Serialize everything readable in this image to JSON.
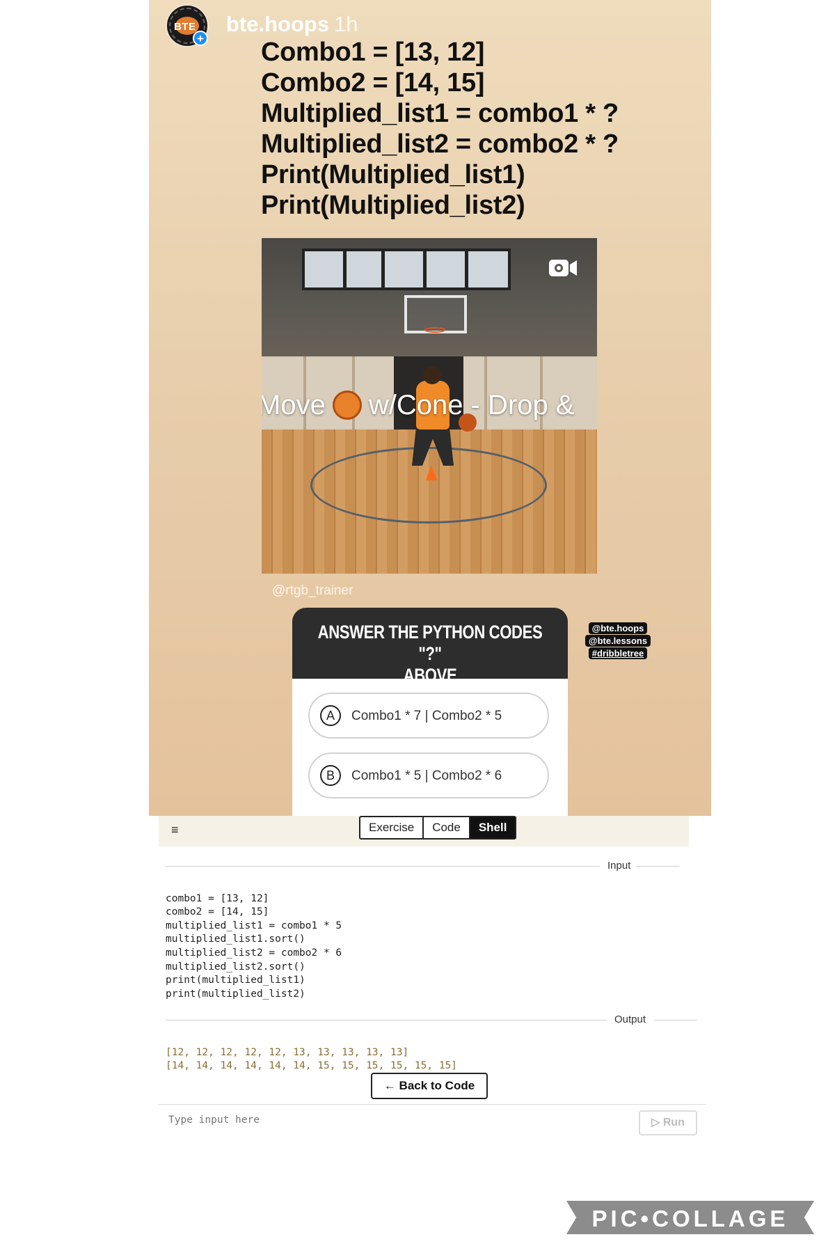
{
  "story": {
    "username": "bte.hoops",
    "time": "1h",
    "avatar_text": "BTE",
    "code_lines": [
      "Combo1 = [13, 12]",
      "Combo2 = [14, 15]",
      "Multiplied_list1 = combo1 * ?",
      "Multiplied_list2 = combo2 * ?",
      "Print(Multiplied_list1)",
      "Print(Multiplied_list2)"
    ],
    "video": {
      "caption_before": "Move",
      "caption_after": "w/Cone - Drop &"
    },
    "credit": "@rtgb_trainer",
    "quiz": {
      "title_line1": "ANSWER THE PYTHON CODES \"?\"",
      "title_line2": "ABOVE",
      "options": [
        {
          "letter": "A",
          "text": "Combo1 * 7 | Combo2 * 5"
        },
        {
          "letter": "B",
          "text": "Combo1 * 5 | Combo2 * 6"
        }
      ]
    },
    "tags": [
      "@bte.hoops",
      "@bte.lessons",
      "#dribbletree"
    ]
  },
  "playground": {
    "menu_icon": "≡",
    "tabs": [
      {
        "label": "Exercise",
        "active": false
      },
      {
        "label": "Code",
        "active": false
      },
      {
        "label": "Shell",
        "active": true
      }
    ],
    "input_label": "Input",
    "input_code": [
      "combo1 = [13, 12]",
      "combo2 = [14, 15]",
      "multiplied_list1 = combo1 * 5",
      "multiplied_list1.sort()",
      "multiplied_list2 = combo2 * 6",
      "multiplied_list2.sort()",
      "print(multiplied_list1)",
      "print(multiplied_list2)"
    ],
    "output_label": "Output",
    "output_lines": [
      "[12, 12, 12, 12, 12, 13, 13, 13, 13, 13]",
      "[14, 14, 14, 14, 14, 14, 15, 15, 15, 15, 15, 15]"
    ],
    "back_button": "← Back to Code",
    "input_placeholder": "Type input here",
    "run_button": "▷ Run"
  },
  "watermark": "PIC•COLLAGE"
}
